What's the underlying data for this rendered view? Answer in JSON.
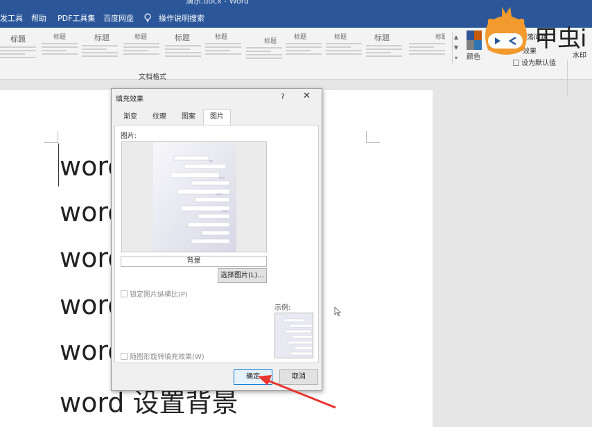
{
  "window": {
    "title": "演示.docx - Word"
  },
  "menu": {
    "items": [
      "发工具",
      "帮助",
      "PDF工具集",
      "百度网盘"
    ],
    "search_label": "操作说明搜索"
  },
  "ribbon": {
    "style_gallery": [
      {
        "heading": "标题"
      },
      {
        "heading": "标题"
      },
      {
        "heading": "标题"
      },
      {
        "heading": "标题"
      },
      {
        "heading": "标题"
      },
      {
        "heading": "标题"
      },
      {
        "heading": "标题"
      },
      {
        "heading": "标题"
      },
      {
        "heading": "标题"
      },
      {
        "heading": "标题"
      },
      {
        "heading": "标题"
      }
    ],
    "group_label": "文档格式",
    "colors_label": "颜色",
    "paragraph_spacing_label": "段落间距",
    "effects_label": "效果",
    "set_default_label": "设为默认值",
    "watermark_label": "水印"
  },
  "logo_text": "甲虫i",
  "document": {
    "lines": [
      "word",
      "word",
      "word",
      "word",
      "word",
      "word 设置背景"
    ]
  },
  "dialog": {
    "title": "填充效果",
    "help": "?",
    "close": "✕",
    "tabs": [
      "渐变",
      "纹理",
      "图案",
      "图片"
    ],
    "active_tab": "图片",
    "picture_label": "图片:",
    "picture_name": "背景",
    "select_picture_button": "选择图片(L)...",
    "lock_aspect_label": "锁定图片纵横比(P)",
    "rotate_with_shape_label": "随图形旋转填充效果(W)",
    "example_label": "示例:",
    "ok_button": "确定",
    "cancel_button": "取消"
  },
  "colors": {
    "ribbon_blue": "#2b579a",
    "accent_red": "#e8352e",
    "logo_orange": "#f29a2e"
  }
}
